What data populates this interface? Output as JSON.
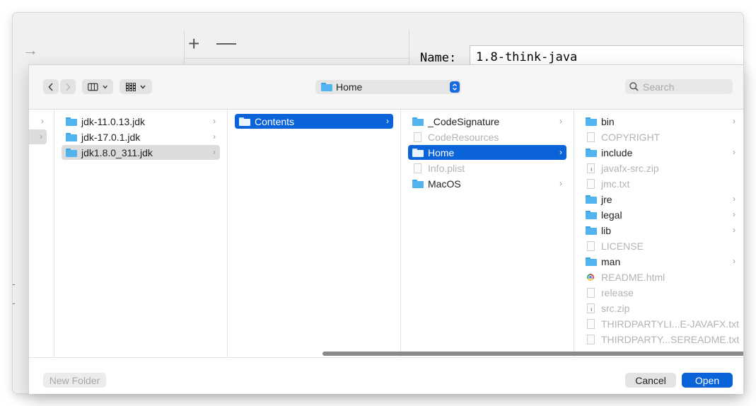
{
  "ide": {
    "name_label": "Name:",
    "name_value": "1.8-think-java",
    "plus_label": "+",
    "minus_label": "—"
  },
  "dialog": {
    "location": "Home",
    "search_placeholder": "Search",
    "columns": {
      "col1": [
        {
          "label": "jdk-11.0.13.jdk",
          "kind": "folder",
          "chevron": true,
          "selected": false
        },
        {
          "label": "jdk-17.0.1.jdk",
          "kind": "folder",
          "chevron": true,
          "selected": false
        },
        {
          "label": "jdk1.8.0_311.jdk",
          "kind": "folder",
          "chevron": true,
          "selected": "gray"
        }
      ],
      "col2": [
        {
          "label": "Contents",
          "kind": "folder",
          "chevron": true,
          "selected": "blue"
        }
      ],
      "col3": [
        {
          "label": "_CodeSignature",
          "kind": "folder",
          "chevron": true
        },
        {
          "label": "CodeResources",
          "kind": "file",
          "dim": true
        },
        {
          "label": "Home",
          "kind": "folder",
          "chevron": true,
          "selected": "blue"
        },
        {
          "label": "Info.plist",
          "kind": "file",
          "dim": true
        },
        {
          "label": "MacOS",
          "kind": "folder",
          "chevron": true
        }
      ],
      "col4": [
        {
          "label": "bin",
          "kind": "folder",
          "chevron": true
        },
        {
          "label": "COPYRIGHT",
          "kind": "file",
          "dim": true
        },
        {
          "label": "include",
          "kind": "folder",
          "chevron": true
        },
        {
          "label": "javafx-src.zip",
          "kind": "zip",
          "dim": true
        },
        {
          "label": "jmc.txt",
          "kind": "file",
          "dim": true
        },
        {
          "label": "jre",
          "kind": "folder",
          "chevron": true
        },
        {
          "label": "legal",
          "kind": "folder",
          "chevron": true
        },
        {
          "label": "lib",
          "kind": "folder",
          "chevron": true
        },
        {
          "label": "LICENSE",
          "kind": "file",
          "dim": true
        },
        {
          "label": "man",
          "kind": "folder",
          "chevron": true
        },
        {
          "label": "README.html",
          "kind": "html",
          "dim": true
        },
        {
          "label": "release",
          "kind": "file",
          "dim": true
        },
        {
          "label": "src.zip",
          "kind": "zip",
          "dim": true
        },
        {
          "label": "THIRDPARTYLI...E-JAVAFX.txt",
          "kind": "file",
          "dim": true
        },
        {
          "label": "THIRDPARTY...SEREADME.txt",
          "kind": "file",
          "dim": true
        }
      ]
    },
    "buttons": {
      "new_folder": "New Folder",
      "cancel": "Cancel",
      "open": "Open"
    }
  },
  "colors": {
    "accent": "#0a63d8",
    "folder": "#52b4ef",
    "selection_gray": "#dcdcdc"
  }
}
